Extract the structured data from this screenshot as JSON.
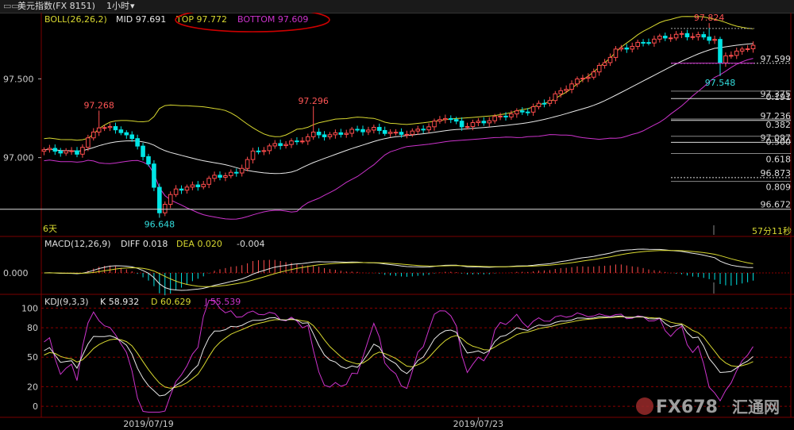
{
  "window": {
    "icon_text": "▭▭",
    "title": "美元指数(FX 8151)",
    "period": "1小时",
    "dropdown_glyph": "▾"
  },
  "boll_legend": {
    "name": "BOLL(26,26,2)",
    "mid": "MID 97.691",
    "top": "TOP 97.772",
    "bottom": "BOTTOM 97.609"
  },
  "macd_legend": {
    "name": "MACD(12,26,9)",
    "diff": "DIFF 0.018",
    "dea": "DEA 0.020",
    "macd": "-0.004"
  },
  "kdj_legend": {
    "name": "KDJ(9,3,3)",
    "k": "K 58.932",
    "d": "D 60.629",
    "j": "J 55.539"
  },
  "info": {
    "days_label": "6天",
    "countdown": "57分11秒"
  },
  "watermark": {
    "brand": "FX678",
    "cn": "汇通网"
  },
  "colors": {
    "up": "#ff4d4d",
    "down": "#00e5e5",
    "boll_band": "#d8d830",
    "boll_mid": "#e8e8e8",
    "boll_bottom": "#cc33cc",
    "macd_diff": "#e8e8e8",
    "macd_dea": "#d8d830",
    "kdj_k": "#e8e8e8",
    "kdj_d": "#d8d830",
    "kdj_j": "#cc33cc",
    "grid": "#8b0000",
    "annotation": "#cc0000",
    "label_high": "#ff5555",
    "label_low": "#33dddd"
  },
  "chart_data": [
    {
      "type": "candlestick",
      "panel": "price",
      "indicator": "BOLL(26,26,2)",
      "ylim": [
        96.6,
        97.88
      ],
      "y_ticks": [
        97.5,
        97.0
      ],
      "y_tick_labels": [
        "97.500",
        "97.000"
      ],
      "x_tick_labels": [
        "2019/07/19",
        "2019/07/23"
      ],
      "x_tick_index": [
        19,
        79
      ],
      "annotations": [
        {
          "text": "97.268",
          "index": 10,
          "kind": "high"
        },
        {
          "text": "96.648",
          "index": 21,
          "kind": "low"
        },
        {
          "text": "97.296",
          "index": 49,
          "kind": "high"
        },
        {
          "text": "97.824",
          "index": 121,
          "kind": "high"
        },
        {
          "text": "97.548",
          "index": 123,
          "kind": "low"
        }
      ],
      "fib_levels": [
        {
          "price": 97.599,
          "label": "97.599"
        },
        {
          "price": 97.375,
          "label": "97.375"
        },
        {
          "price": 97.236,
          "label": "97.236"
        },
        {
          "price": 97.097,
          "label": "97.097"
        },
        {
          "price": 96.873,
          "label": "96.873"
        },
        {
          "price": 96.672,
          "label": "96.672"
        }
      ],
      "fib_ratios": [
        "0.191",
        "0.382",
        "0.500",
        "0.618",
        "0.809"
      ],
      "series_names": [
        "MID",
        "TOP",
        "BOTTOM"
      ]
    },
    {
      "type": "line",
      "panel": "macd",
      "indicator": "MACD(12,26,9)",
      "y_ticks": [
        0.0
      ],
      "y_tick_labels": [
        "0.000"
      ],
      "series_names": [
        "DIFF",
        "DEA",
        "MACD"
      ]
    },
    {
      "type": "line",
      "panel": "kdj",
      "indicator": "KDJ(9,3,3)",
      "ylim": [
        -8,
        110
      ],
      "y_ticks": [
        100,
        80,
        50,
        20,
        0
      ],
      "y_tick_labels": [
        "100",
        "80",
        "50",
        "20",
        "0"
      ],
      "series_names": [
        "K",
        "D",
        "J"
      ]
    }
  ]
}
